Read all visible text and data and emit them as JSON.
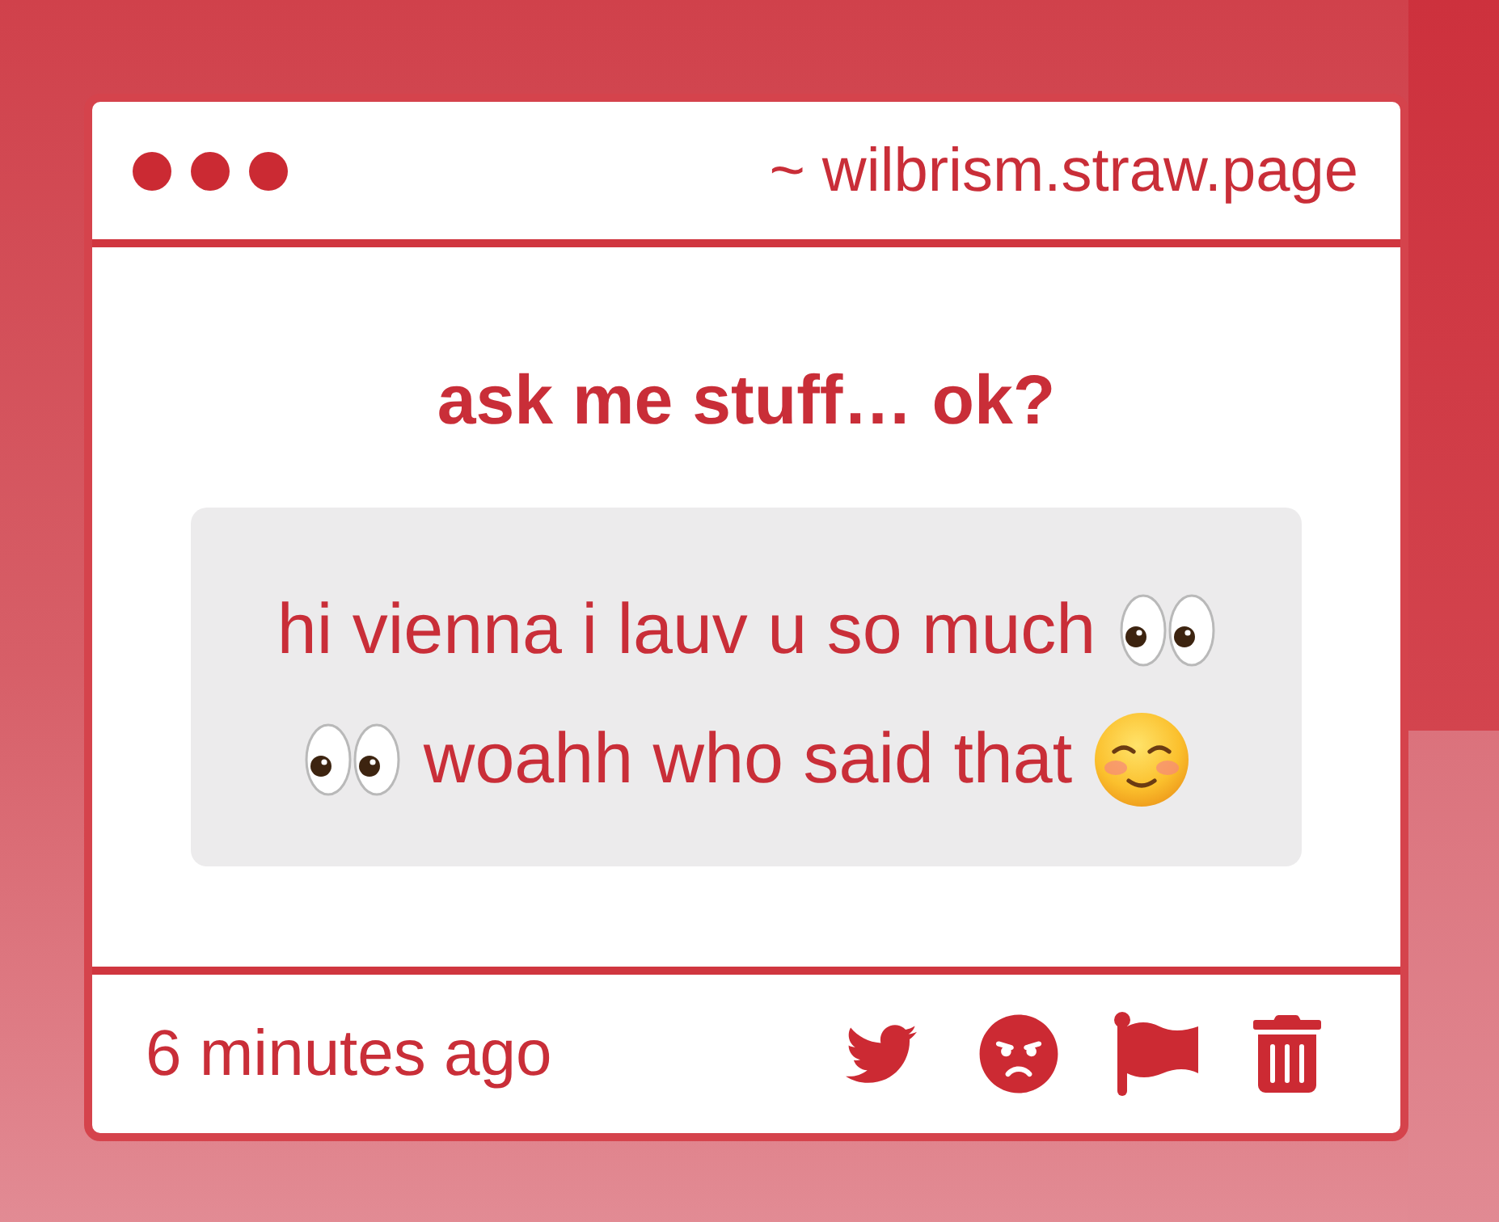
{
  "window": {
    "url": "~ wilbrism.straw.page"
  },
  "title": "ask me stuff… ok?",
  "message": {
    "lines": [
      [
        {
          "kind": "text",
          "text": "hi vienna i lauv u so much"
        },
        {
          "kind": "eyes"
        }
      ],
      [
        {
          "kind": "eyes"
        },
        {
          "kind": "text",
          "text": "woahh who said that"
        },
        {
          "kind": "blush"
        }
      ]
    ]
  },
  "footer": {
    "time": "6 minutes ago"
  }
}
